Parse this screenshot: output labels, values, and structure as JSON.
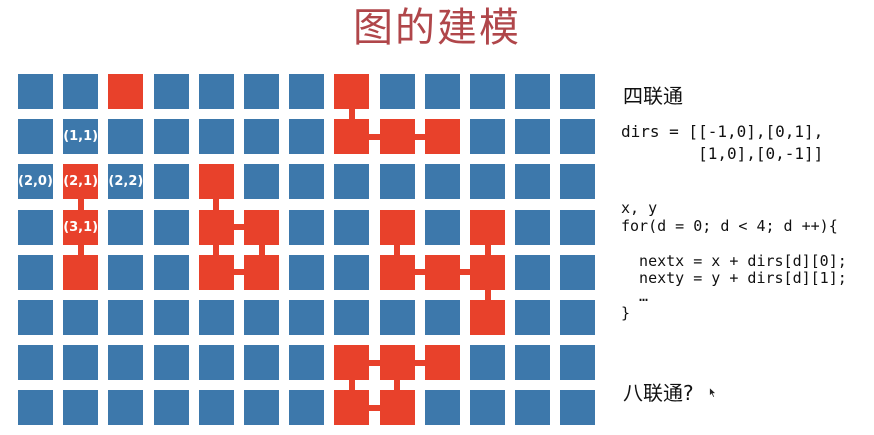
{
  "title": "图的建模",
  "grid": {
    "rows": 8,
    "cols": 13,
    "colors": {
      "cell": "#3d78ab",
      "highlight": "#e8412b",
      "label": "#ffffff"
    },
    "red_cells": [
      [
        0,
        2
      ],
      [
        2,
        1
      ],
      [
        3,
        1
      ],
      [
        4,
        1
      ],
      [
        2,
        4
      ],
      [
        3,
        4
      ],
      [
        3,
        5
      ],
      [
        4,
        4
      ],
      [
        4,
        5
      ],
      [
        0,
        7
      ],
      [
        1,
        7
      ],
      [
        1,
        8
      ],
      [
        1,
        9
      ],
      [
        3,
        8
      ],
      [
        4,
        8
      ],
      [
        4,
        9
      ],
      [
        4,
        10
      ],
      [
        3,
        10
      ],
      [
        5,
        10
      ],
      [
        6,
        7
      ],
      [
        6,
        8
      ],
      [
        6,
        9
      ],
      [
        7,
        7
      ],
      [
        7,
        8
      ]
    ],
    "connections": [
      [
        [
          2,
          1
        ],
        [
          3,
          1
        ]
      ],
      [
        [
          3,
          1
        ],
        [
          4,
          1
        ]
      ],
      [
        [
          2,
          4
        ],
        [
          3,
          4
        ]
      ],
      [
        [
          3,
          4
        ],
        [
          3,
          5
        ]
      ],
      [
        [
          3,
          4
        ],
        [
          4,
          4
        ]
      ],
      [
        [
          4,
          4
        ],
        [
          4,
          5
        ]
      ],
      [
        [
          3,
          5
        ],
        [
          4,
          5
        ]
      ],
      [
        [
          0,
          7
        ],
        [
          1,
          7
        ]
      ],
      [
        [
          1,
          7
        ],
        [
          1,
          8
        ]
      ],
      [
        [
          1,
          8
        ],
        [
          1,
          9
        ]
      ],
      [
        [
          3,
          8
        ],
        [
          4,
          8
        ]
      ],
      [
        [
          4,
          8
        ],
        [
          4,
          9
        ]
      ],
      [
        [
          4,
          9
        ],
        [
          4,
          10
        ]
      ],
      [
        [
          3,
          10
        ],
        [
          4,
          10
        ]
      ],
      [
        [
          4,
          10
        ],
        [
          5,
          10
        ]
      ],
      [
        [
          6,
          7
        ],
        [
          6,
          8
        ]
      ],
      [
        [
          6,
          8
        ],
        [
          6,
          9
        ]
      ],
      [
        [
          6,
          7
        ],
        [
          7,
          7
        ]
      ],
      [
        [
          6,
          8
        ],
        [
          7,
          8
        ]
      ],
      [
        [
          7,
          7
        ],
        [
          7,
          8
        ]
      ]
    ],
    "labels": [
      {
        "text": "(1,1)",
        "row": 1,
        "col": 1
      },
      {
        "text": "(2,0)",
        "row": 2,
        "col": 0
      },
      {
        "text": "(2,1)",
        "row": 2,
        "col": 1
      },
      {
        "text": "(2,2)",
        "row": 2,
        "col": 2
      },
      {
        "text": "(3,1)",
        "row": 3,
        "col": 1
      }
    ]
  },
  "side": {
    "four_title": "四联通",
    "dirs_code": "dirs = [[-1,0],[0,1],\n        [1,0],[0,-1]]",
    "loop_code": "x, y\nfor(d = 0; d < 4; d ++){\n\n  nextx = x + dirs[d][0];\n  nexty = y + dirs[d][1];\n  …\n}",
    "eight_title": "八联通?"
  }
}
